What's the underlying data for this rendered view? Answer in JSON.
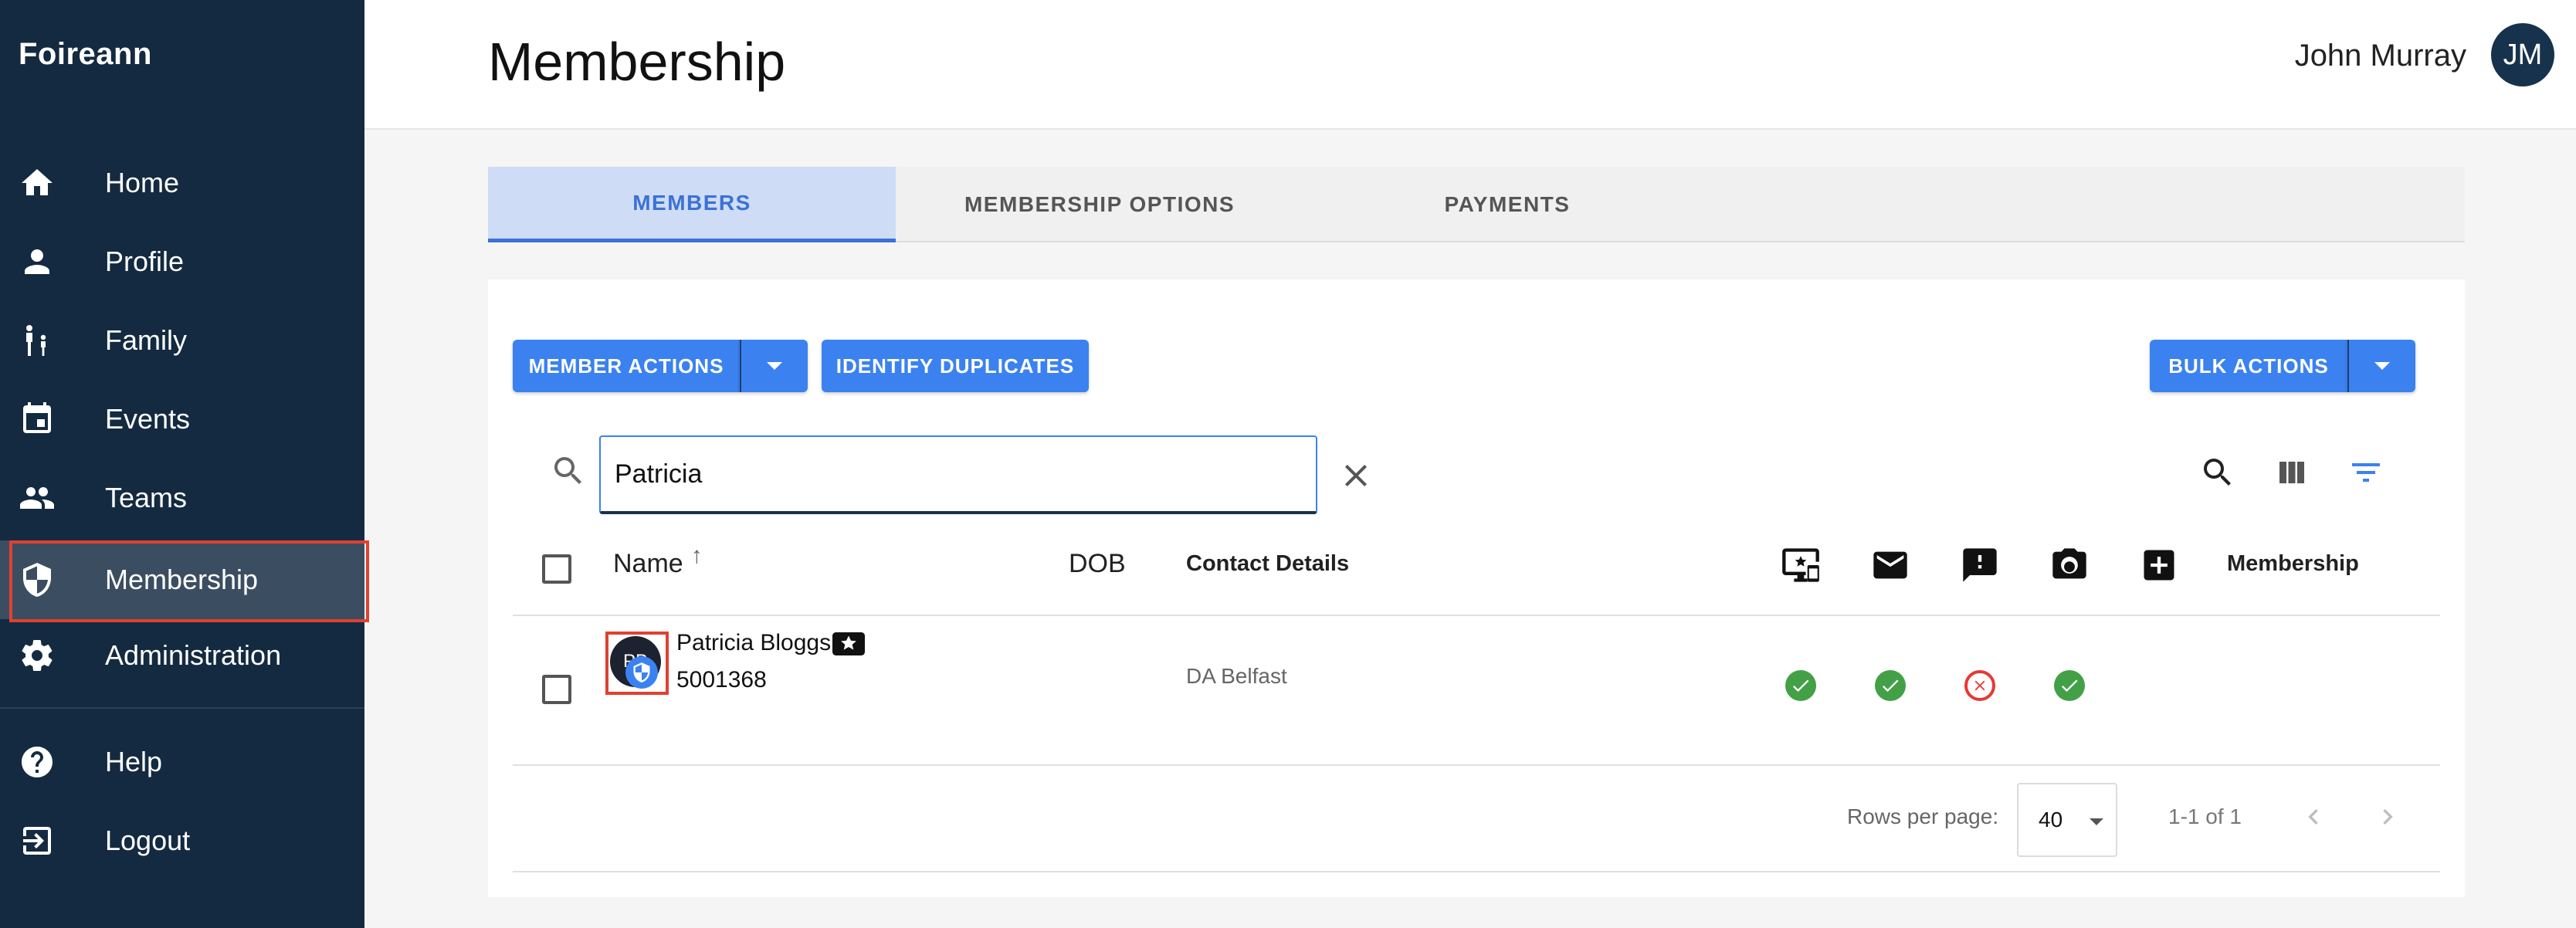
{
  "app": {
    "brand": "Foireann"
  },
  "sidebar": {
    "items": [
      {
        "label": "Home",
        "icon": "home-icon"
      },
      {
        "label": "Profile",
        "icon": "person-icon"
      },
      {
        "label": "Family",
        "icon": "family-icon"
      },
      {
        "label": "Events",
        "icon": "calendar-icon"
      },
      {
        "label": "Teams",
        "icon": "group-icon"
      },
      {
        "label": "Membership",
        "icon": "shield-icon",
        "active": true
      },
      {
        "label": "Administration",
        "icon": "gear-icon"
      }
    ],
    "bottom_items": [
      {
        "label": "Help",
        "icon": "help-icon"
      },
      {
        "label": "Logout",
        "icon": "logout-icon"
      }
    ]
  },
  "header": {
    "title": "Membership",
    "user_name": "John Murray",
    "avatar_initials": "JM"
  },
  "tabs": [
    {
      "label": "MEMBERS",
      "active": true
    },
    {
      "label": "MEMBERSHIP OPTIONS"
    },
    {
      "label": "PAYMENTS"
    }
  ],
  "toolbar": {
    "member_actions_label": "MEMBER ACTIONS",
    "identify_duplicates_label": "IDENTIFY DUPLICATES",
    "bulk_actions_label": "BULK ACTIONS"
  },
  "search": {
    "value": "Patricia"
  },
  "table": {
    "headers": {
      "name": "Name",
      "dob": "DOB",
      "contact": "Contact Details",
      "membership": "Membership"
    },
    "header_icons": [
      "device-star-icon",
      "email-icon",
      "alert-icon",
      "camera-icon",
      "medical-cross-icon"
    ],
    "rows": [
      {
        "avatar_initials": "PB",
        "name": "Patricia Bloggs",
        "member_id": "5001368",
        "dob": "",
        "contact": "DA Belfast",
        "statuses": [
          "ok",
          "ok",
          "no",
          "ok",
          ""
        ],
        "membership": ""
      }
    ]
  },
  "pagination": {
    "rows_per_page_label": "Rows per page:",
    "rows_per_page": "40",
    "range": "1-1 of 1"
  },
  "colors": {
    "sidebar_bg": "#132a40",
    "accent": "#3b82f0",
    "success": "#43a047",
    "error": "#e53935",
    "highlight": "#e0412f"
  }
}
